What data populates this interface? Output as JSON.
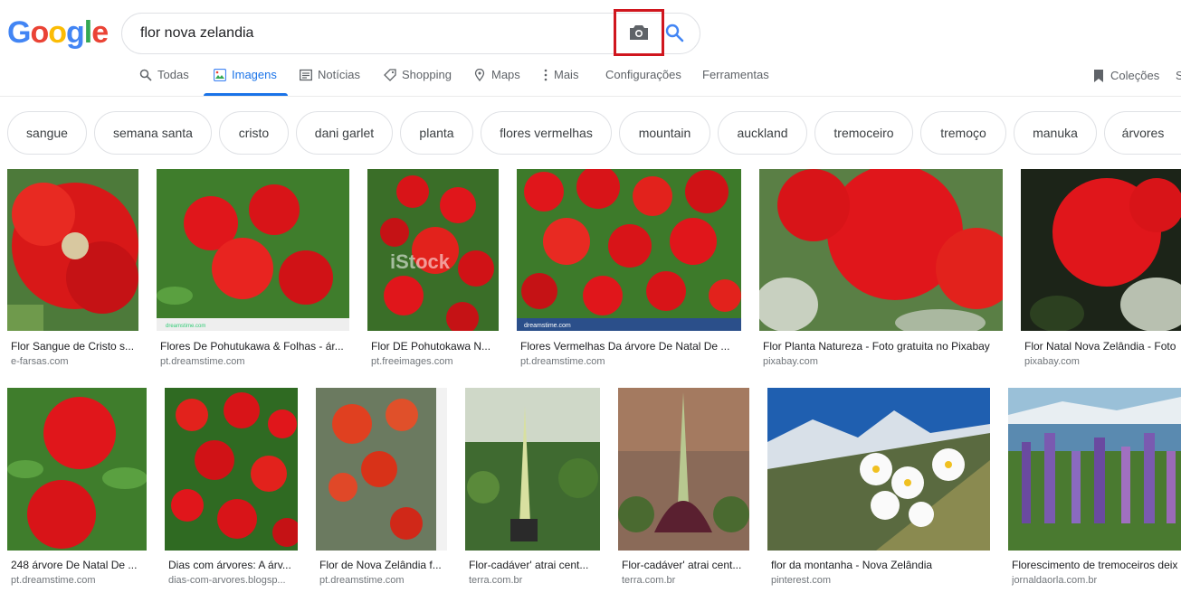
{
  "logo": {
    "letters": [
      "G",
      "o",
      "o",
      "g",
      "l",
      "e"
    ],
    "colors": [
      "#4285f4",
      "#ea4335",
      "#fbbc05",
      "#4285f4",
      "#34a853",
      "#ea4335"
    ]
  },
  "search": {
    "query": "flor nova zelandia"
  },
  "tabs": [
    {
      "label": "Todas",
      "icon": "search-icon"
    },
    {
      "label": "Imagens",
      "icon": "images-icon",
      "active": true
    },
    {
      "label": "Notícias",
      "icon": "news-icon"
    },
    {
      "label": "Shopping",
      "icon": "tag-icon"
    },
    {
      "label": "Maps",
      "icon": "map-pin-icon"
    },
    {
      "label": "Mais",
      "icon": "more-vert-icon"
    },
    {
      "label": "Configurações"
    },
    {
      "label": "Ferramentas"
    }
  ],
  "collections": {
    "label": "Coleções",
    "edge_letter": "S"
  },
  "chips": [
    "sangue",
    "semana santa",
    "cristo",
    "dani garlet",
    "planta",
    "flores vermelhas",
    "mountain",
    "auckland",
    "tremoceiro",
    "tremoço",
    "manuka",
    "árvores"
  ],
  "results_row1": [
    {
      "title": "Flor Sangue de Cristo s...",
      "source": "e-farsas.com"
    },
    {
      "title": "Flores De Pohutukawa & Folhas - ár...",
      "source": "pt.dreamstime.com"
    },
    {
      "title": "Flor DE Pohutokawa N...",
      "source": "pt.freeimages.com"
    },
    {
      "title": "Flores Vermelhas Da árvore De Natal De ...",
      "source": "pt.dreamstime.com"
    },
    {
      "title": "Flor Planta Natureza - Foto gratuita no Pixabay",
      "source": "pixabay.com"
    },
    {
      "title": "Flor Natal Nova Zelândia - Foto",
      "source": "pixabay.com"
    }
  ],
  "results_row2": [
    {
      "title": "248 árvore De Natal De ...",
      "source": "pt.dreamstime.com"
    },
    {
      "title": "Dias com árvores: A árv...",
      "source": "dias-com-arvores.blogsp..."
    },
    {
      "title": "Flor de Nova Zelândia f...",
      "source": "pt.dreamstime.com"
    },
    {
      "title": "Flor-cadáver' atrai cent...",
      "source": "terra.com.br"
    },
    {
      "title": "Flor-cadáver' atrai cent...",
      "source": "terra.com.br"
    },
    {
      "title": "flor da montanha - Nova Zelândia",
      "source": "pinterest.com"
    },
    {
      "title": "Florescimento de tremoceiros deix",
      "source": "jornaldaorla.com.br"
    }
  ],
  "watermarks": {
    "istock": "iStock",
    "dreamstime": "dreamstime.com"
  },
  "colors": {
    "accent": "#1a73e8",
    "highlight_box": "#d0161e",
    "flower_red": "#e0161b",
    "leaf_green": "#3f7d2c"
  }
}
